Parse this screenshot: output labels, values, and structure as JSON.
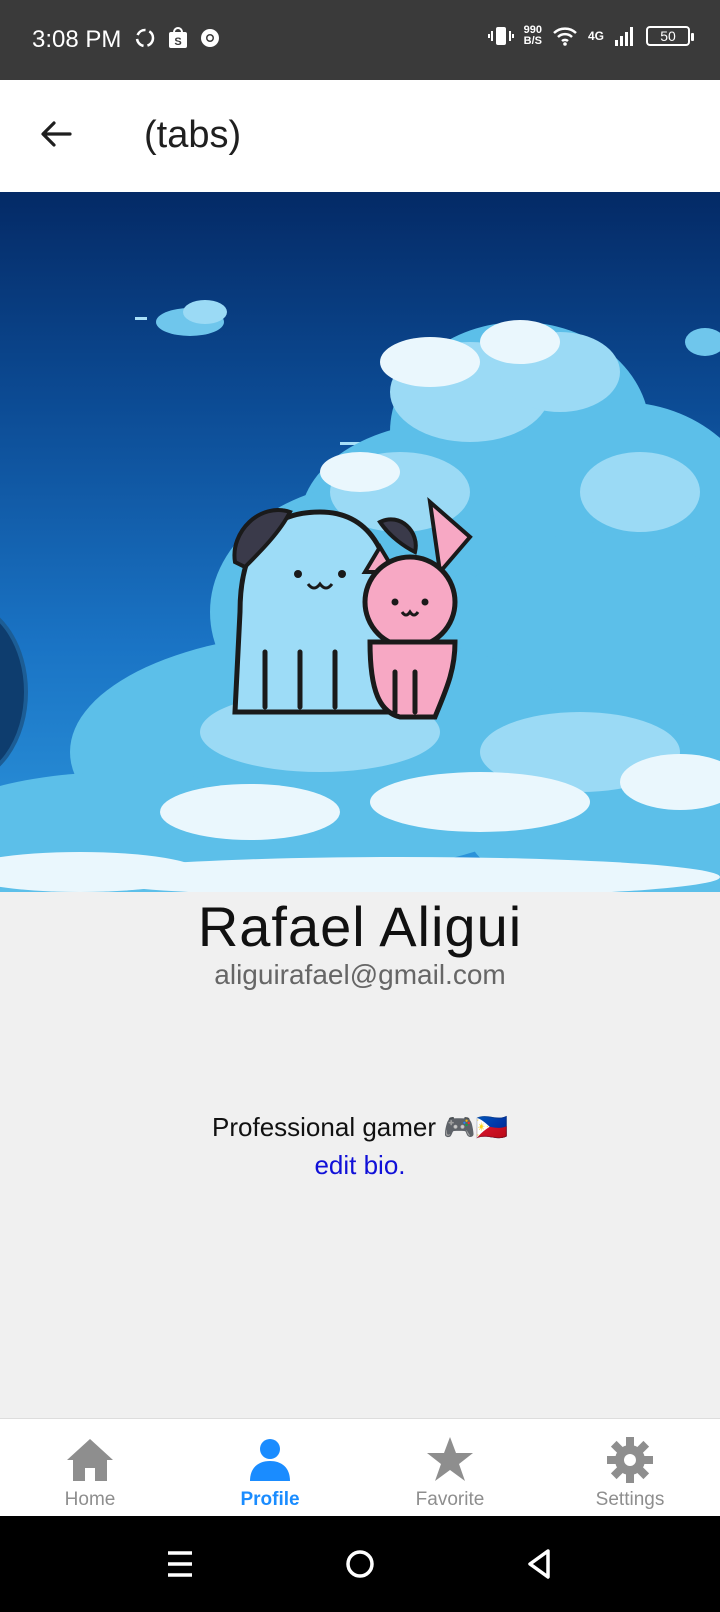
{
  "status_bar": {
    "time": "3:08 PM",
    "net_speed_value": "990",
    "net_speed_unit": "B/S",
    "network": "4G",
    "battery": "50",
    "left_icons": [
      "sync-icon",
      "shop-icon",
      "chrome-icon"
    ],
    "right_icons": [
      "vibrate-icon",
      "wifi-icon",
      "signal-icon",
      "battery-icon"
    ]
  },
  "app_bar": {
    "title": "(tabs)",
    "back_icon": "arrow-left-icon"
  },
  "profile": {
    "name": "Rafael Aligui",
    "email": "aliguirafael@gmail.com",
    "bio": "Professional gamer 🎮🇵🇭",
    "edit_bio": "edit bio."
  },
  "tabs": [
    {
      "label": "Home",
      "icon": "home-icon",
      "active": false
    },
    {
      "label": "Profile",
      "icon": "user-icon",
      "active": true
    },
    {
      "label": "Favorite",
      "icon": "star-icon",
      "active": false
    },
    {
      "label": "Settings",
      "icon": "gear-icon",
      "active": false
    }
  ],
  "colors": {
    "active_tab": "#1a8cff",
    "inactive_tab": "#8e8e8e",
    "link": "#1010d8",
    "status_bar": "#3a3a3a"
  }
}
